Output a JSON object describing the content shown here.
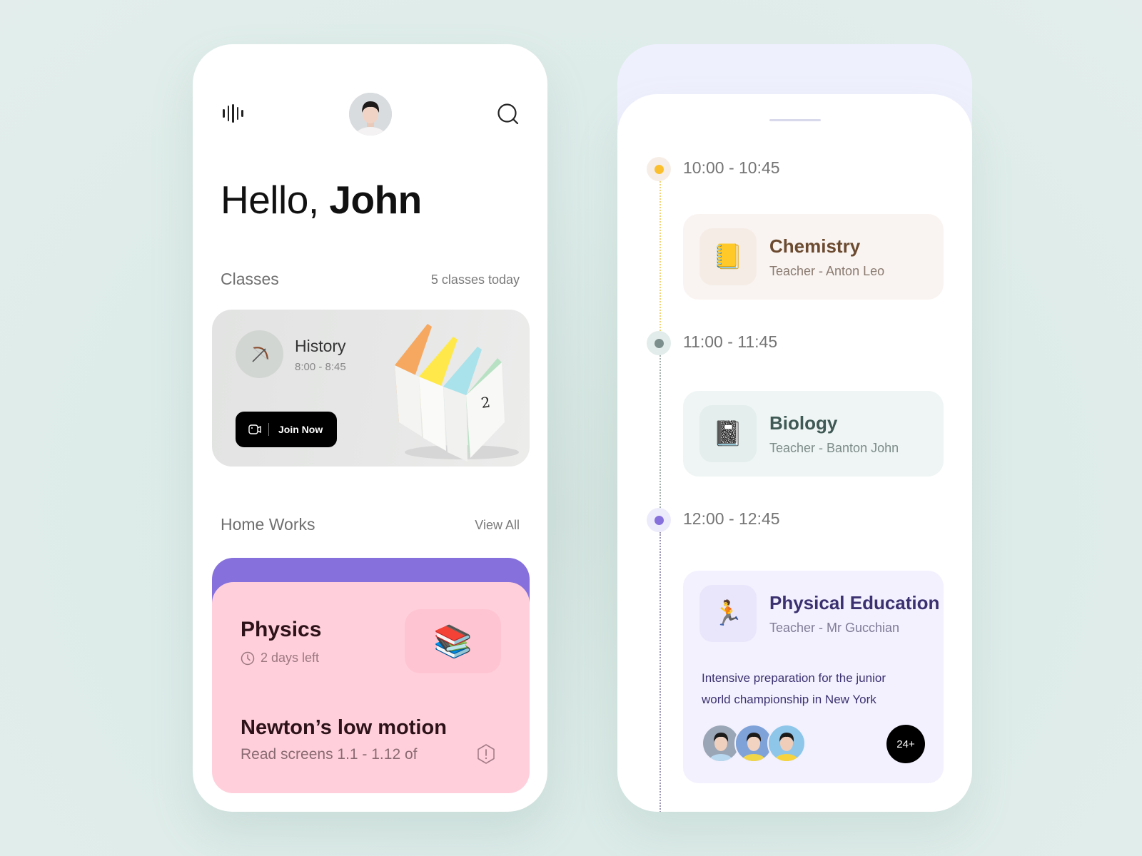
{
  "home": {
    "greeting_prefix": "Hello,",
    "user_name": "John",
    "classes": {
      "title": "Classes",
      "count_label": "5 classes today",
      "current": {
        "name": "History",
        "time": "8:00 - 8:45",
        "icon": "bow-and-arrow-icon",
        "join_label": "Join Now"
      }
    },
    "homework": {
      "title": "Home Works",
      "view_all_label": "View All",
      "item": {
        "subject": "Physics",
        "due": "2 days left",
        "emoji": "📚",
        "task": "Newton’s low motion",
        "task_desc": "Read screens 1.1 - 1.12 of"
      }
    },
    "colors": {
      "accent_purple": "#8670dc",
      "homework_pink": "#ffd0dc"
    }
  },
  "schedule": {
    "items": [
      {
        "time": "10:00 - 10:45",
        "subject": "Chemistry",
        "teacher": "Teacher - Anton Leo",
        "emoji": "📒",
        "dot_color": "#fbbf2e"
      },
      {
        "time": "11:00 - 11:45",
        "subject": "Biology",
        "teacher": "Teacher - Banton John",
        "emoji": "📓",
        "dot_color": "#7c8f8c"
      },
      {
        "time": "12:00 - 12:45",
        "subject": "Physical Education",
        "teacher": "Teacher - Mr Gucchian",
        "emoji": "🏃",
        "dot_color": "#8670dc",
        "description": "Intensive preparation for the junior world championship in New York",
        "participants_more": "24+"
      }
    ]
  }
}
